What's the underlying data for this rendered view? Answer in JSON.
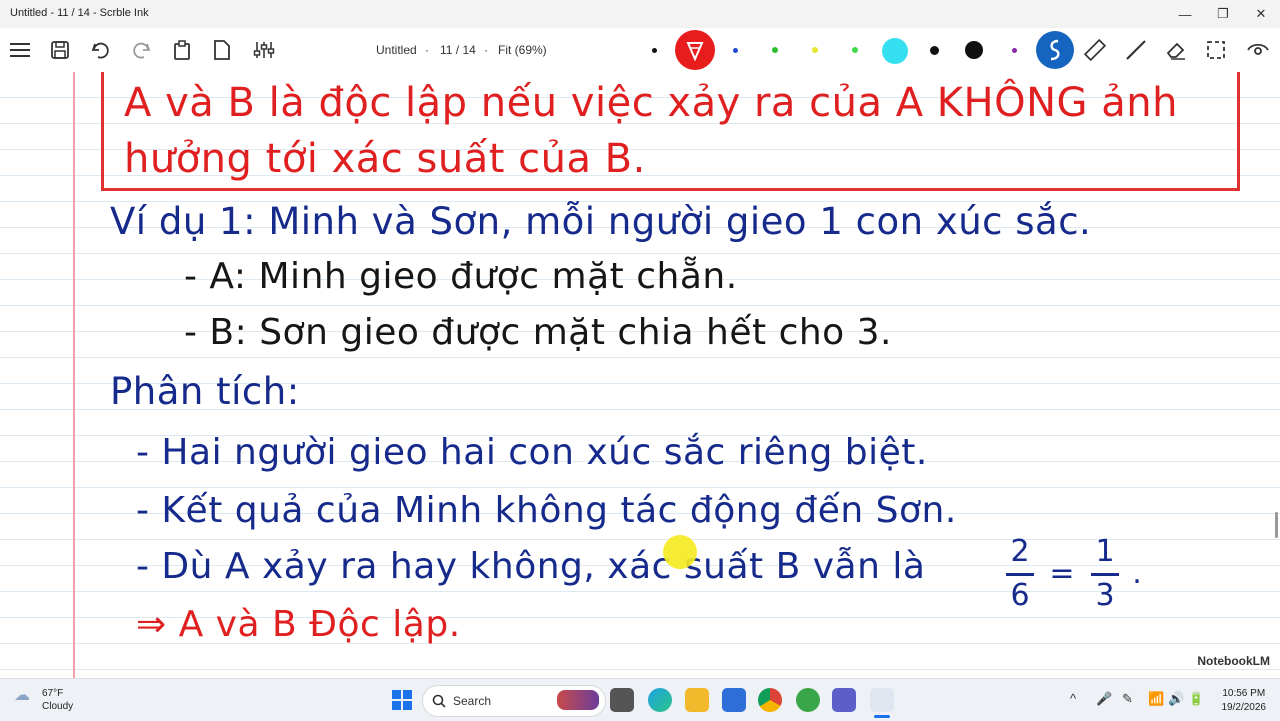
{
  "window": {
    "title": "Untitled - 11 / 14 - Scrble Ink",
    "minimize": "—",
    "maximize": "❐",
    "close": "✕"
  },
  "toolbar": {
    "doc_name": "Untitled",
    "sep1": "·",
    "page": "11 / 14",
    "sep2": "·",
    "zoom": "Fit (69%)",
    "icons": [
      "menu-icon",
      "save-icon",
      "undo-icon",
      "redo-icon",
      "clipboard-icon",
      "page-icon",
      "settings-sliders-icon"
    ],
    "tool_icons": [
      "pen-tool-icon",
      "ruler-icon",
      "line-icon",
      "eraser-icon",
      "select-icon",
      "view-icon"
    ],
    "colors": {
      "active_pen": "#e81c1c",
      "blue": "#1e4bd2",
      "green": "#2bbf2b",
      "yellow": "#e6e633",
      "lightgreen": "#3fd94a",
      "cyan": "#34e0f0",
      "black": "#111111",
      "purple": "#8a2aa8",
      "highlight": "#1565c0"
    }
  },
  "content": {
    "box_line1": "A và B là độc lập nếu việc xảy ra của A KHÔNG ảnh",
    "box_line2": "hưởng tới xác suất của B.",
    "example_title": "Ví dụ 1: Minh và Sơn, mỗi người gieo 1 con xúc sắc.",
    "event_a": "- A: Minh gieo được mặt chẵn.",
    "event_b": "- B: Sơn gieo được mặt chia hết cho 3.",
    "analysis_title": "Phân tích:",
    "point1": "- Hai người gieo hai con xúc sắc riêng biệt.",
    "point2": "- Kết quả của Minh không tác động đến Sơn.",
    "point3": "- Dù A xảy ra hay không, xác suất B vẫn là",
    "frac1_num": "2",
    "frac1_den": "6",
    "equals": "=",
    "frac2_num": "1",
    "frac2_den": "3",
    "period": ".",
    "conclusion": "⇒ A và B Độc lập.",
    "watermark": "NotebookLM"
  },
  "taskbar": {
    "weather_temp": "67°F",
    "weather_desc": "Cloudy",
    "search_label": "Search",
    "time": "10:56 PM",
    "date": "19/2/2026",
    "apps": [
      "start-icon",
      "widget-icon",
      "file-icon",
      "edge-icon",
      "explorer-icon",
      "store-icon",
      "chrome-icon",
      "app-icon",
      "teams-icon",
      "scrble-icon"
    ],
    "tray": [
      "^",
      "🎤",
      "✎",
      "📶",
      "🔊",
      "🔋"
    ]
  }
}
